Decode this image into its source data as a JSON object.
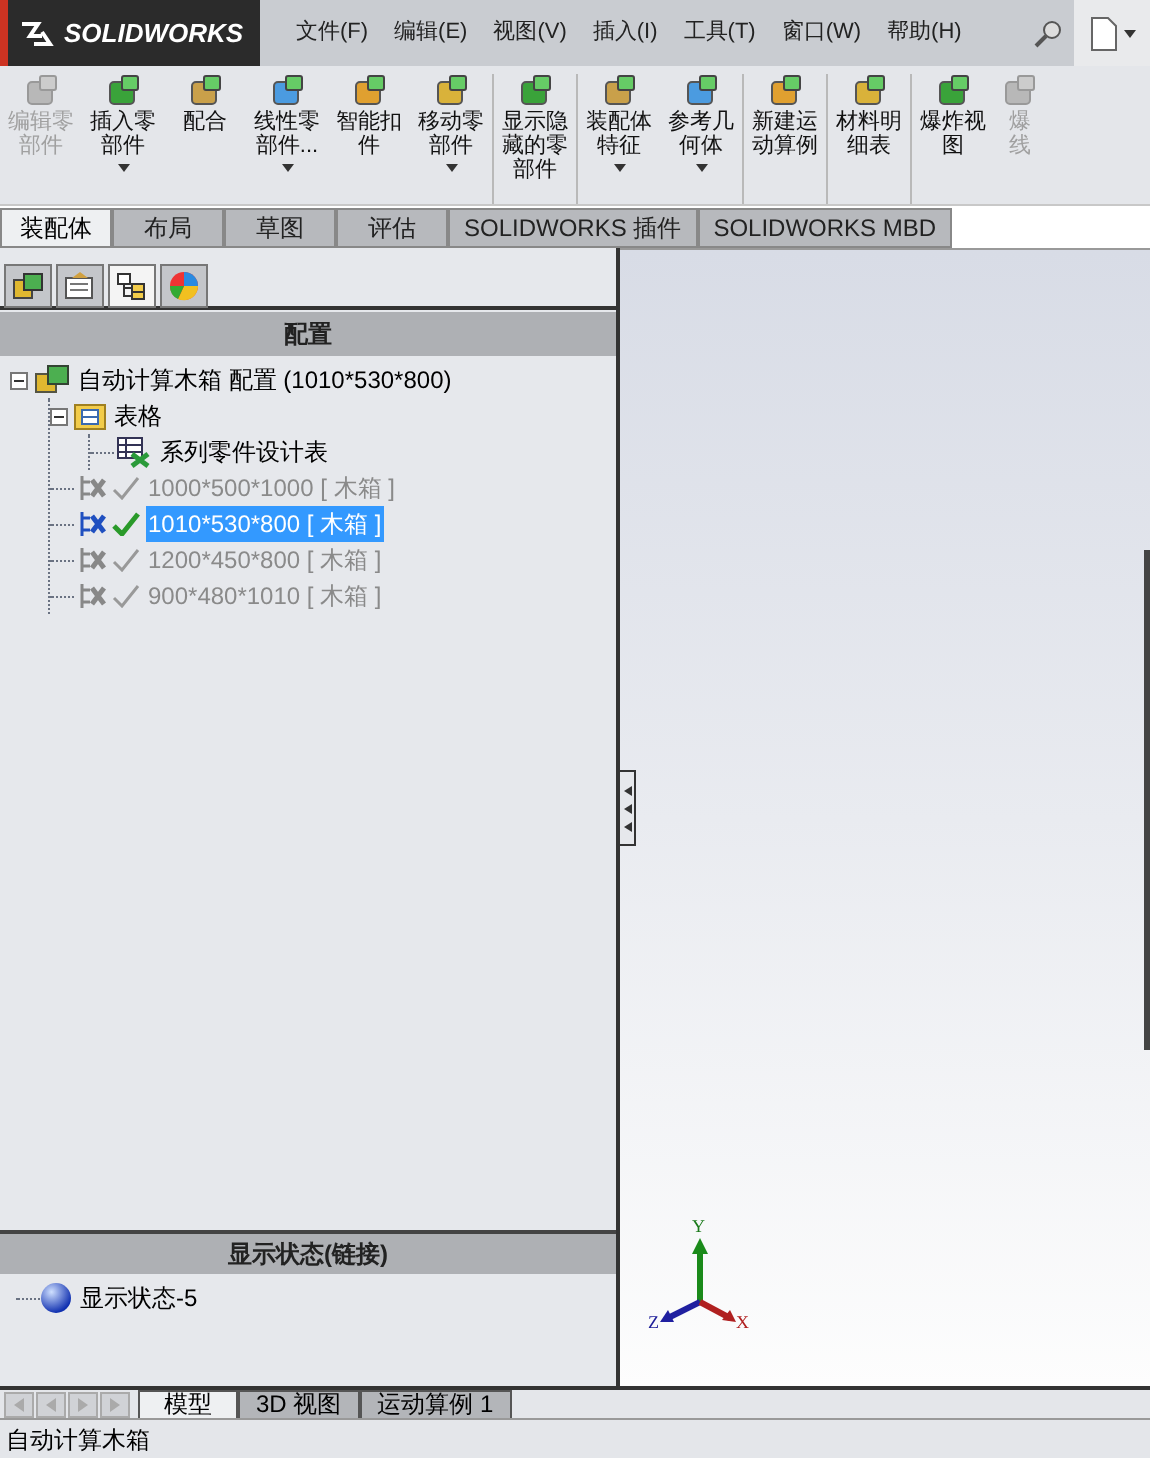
{
  "app": {
    "logo": "SOLIDWORKS"
  },
  "menu": [
    "文件(F)",
    "编辑(E)",
    "视图(V)",
    "插入(I)",
    "工具(T)",
    "窗口(W)",
    "帮助(H)"
  ],
  "toolbar": [
    {
      "label": "编辑零部件",
      "disabled": true,
      "dropdown": false,
      "group_end": false
    },
    {
      "label": "插入零部件",
      "disabled": false,
      "dropdown": true,
      "group_end": false
    },
    {
      "label": "配合",
      "disabled": false,
      "dropdown": false,
      "group_end": false
    },
    {
      "label": "线性零部件...",
      "disabled": false,
      "dropdown": true,
      "group_end": false
    },
    {
      "label": "智能扣件",
      "disabled": false,
      "dropdown": false,
      "group_end": false
    },
    {
      "label": "移动零部件",
      "disabled": false,
      "dropdown": true,
      "group_end": true
    },
    {
      "label": "显示隐藏的零部件",
      "disabled": false,
      "dropdown": false,
      "group_end": true
    },
    {
      "label": "装配体特征",
      "disabled": false,
      "dropdown": true,
      "group_end": false
    },
    {
      "label": "参考几何体",
      "disabled": false,
      "dropdown": true,
      "group_end": true
    },
    {
      "label": "新建运动算例",
      "disabled": false,
      "dropdown": false,
      "group_end": true
    },
    {
      "label": "材料明细表",
      "disabled": false,
      "dropdown": false,
      "group_end": true
    },
    {
      "label": "爆炸视图",
      "disabled": false,
      "dropdown": false,
      "group_end": false
    },
    {
      "label": "爆线",
      "disabled": true,
      "dropdown": false,
      "group_end": false
    }
  ],
  "tabs": [
    {
      "label": "装配体",
      "selected": true
    },
    {
      "label": "布局",
      "selected": false
    },
    {
      "label": "草图",
      "selected": false
    },
    {
      "label": "评估",
      "selected": false
    },
    {
      "label": "SOLIDWORKS 插件",
      "selected": false
    },
    {
      "label": "SOLIDWORKS MBD",
      "selected": false
    }
  ],
  "panel_tabs": [
    {
      "kind": "feature",
      "selected": false
    },
    {
      "kind": "property",
      "selected": false
    },
    {
      "kind": "config",
      "selected": true
    },
    {
      "kind": "display",
      "selected": false
    }
  ],
  "config_header": "配置",
  "tree": [
    {
      "kind": "assembly",
      "label": "自动计算木箱 配置  (1010*530*800)",
      "expanded": true,
      "children": [
        {
          "kind": "folder",
          "label": "表格",
          "expanded": true,
          "children": [
            {
              "kind": "table",
              "label": "系列零件设计表"
            }
          ]
        },
        {
          "kind": "config",
          "label": "1000*500*1000 [ 木箱 ]",
          "selected": false
        },
        {
          "kind": "config",
          "label": "1010*530*800 [ 木箱 ]",
          "selected": true
        },
        {
          "kind": "config",
          "label": "1200*450*800 [ 木箱 ]",
          "selected": false
        },
        {
          "kind": "config",
          "label": "900*480*1010 [ 木箱 ]",
          "selected": false
        }
      ]
    }
  ],
  "display_header": "显示状态(链接)",
  "display_states": [
    {
      "label": "显示状态-5"
    }
  ],
  "triad": {
    "y": "Y",
    "z": "Z",
    "x": "X"
  },
  "bottom_tabs": [
    {
      "label": "模型",
      "selected": true
    },
    {
      "label": "3D 视图",
      "selected": false
    },
    {
      "label": "运动算例 1",
      "selected": false
    }
  ],
  "status_bar": "自动计算木箱"
}
